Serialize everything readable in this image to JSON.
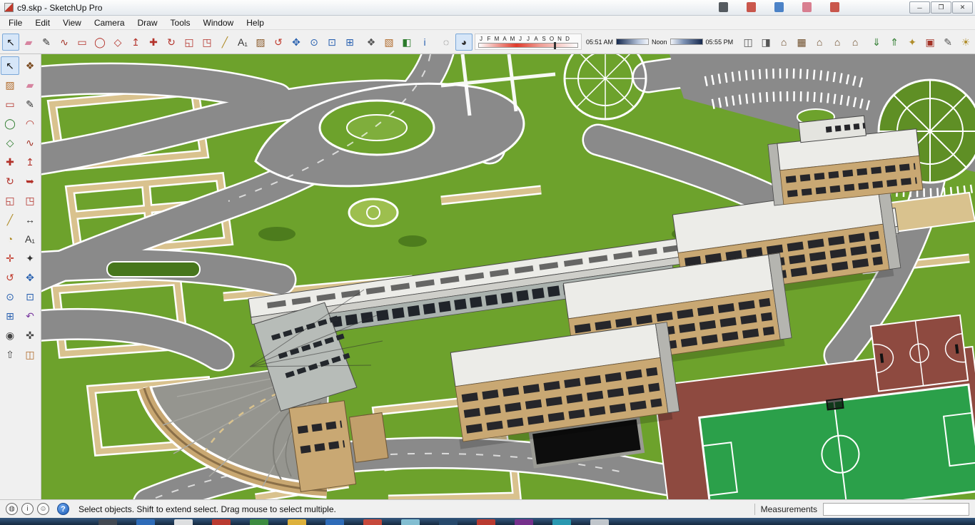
{
  "window": {
    "title": "c9.skp - SketchUp Pro",
    "controls": [
      {
        "name": "minimize-button",
        "glyph": "─"
      },
      {
        "name": "restore-button",
        "glyph": "❐"
      },
      {
        "name": "close-button",
        "glyph": "✕"
      }
    ]
  },
  "titlebar_artifacts": [
    "#3a3f45",
    "#c23b2e",
    "#2f6fbe",
    "#d46a7e",
    "#c23b2e"
  ],
  "menu": {
    "items": [
      {
        "name": "menu-file",
        "label": "File"
      },
      {
        "name": "menu-edit",
        "label": "Edit"
      },
      {
        "name": "menu-view",
        "label": "View"
      },
      {
        "name": "menu-camera",
        "label": "Camera"
      },
      {
        "name": "menu-draw",
        "label": "Draw"
      },
      {
        "name": "menu-tools",
        "label": "Tools"
      },
      {
        "name": "menu-window",
        "label": "Window"
      },
      {
        "name": "menu-help",
        "label": "Help"
      }
    ]
  },
  "toolbar": {
    "main_icons": [
      {
        "name": "select-icon",
        "glyph": "↖",
        "color": "#111111",
        "active": true
      },
      {
        "name": "eraser-icon",
        "glyph": "▰",
        "color": "#d784a0"
      },
      {
        "name": "line-icon",
        "glyph": "✎",
        "color": "#333333"
      },
      {
        "name": "freehand-icon",
        "glyph": "∿",
        "color": "#a33327"
      },
      {
        "name": "rectangle-icon",
        "glyph": "▭",
        "color": "#b3322a"
      },
      {
        "name": "circle-icon",
        "glyph": "◯",
        "color": "#b3322a"
      },
      {
        "name": "polygon-icon",
        "glyph": "◇",
        "color": "#b3322a"
      },
      {
        "name": "push-pull-icon",
        "glyph": "↥",
        "color": "#b3322a"
      },
      {
        "name": "move-icon",
        "glyph": "✚",
        "color": "#b3322a"
      },
      {
        "name": "rotate-icon",
        "glyph": "↻",
        "color": "#b3322a"
      },
      {
        "name": "scale-icon",
        "glyph": "◱",
        "color": "#b3322a"
      },
      {
        "name": "offset-icon",
        "glyph": "◳",
        "color": "#b3322a"
      },
      {
        "name": "tape-measure-icon",
        "glyph": "╱",
        "color": "#b08d2a"
      },
      {
        "name": "text-icon",
        "glyph": "A₁",
        "color": "#333333"
      },
      {
        "name": "paint-bucket-icon",
        "glyph": "▨",
        "color": "#8a5a2a"
      },
      {
        "name": "orbit-icon",
        "glyph": "↺",
        "color": "#c0392b"
      },
      {
        "name": "pan-icon",
        "glyph": "✥",
        "color": "#2a62b0"
      },
      {
        "name": "zoom-icon",
        "glyph": "⊙",
        "color": "#2a62b0"
      },
      {
        "name": "zoom-window-icon",
        "glyph": "⊡",
        "color": "#2a62b0"
      },
      {
        "name": "zoom-extents-icon",
        "glyph": "⊞",
        "color": "#2a62b0"
      }
    ],
    "mid_icons": [
      {
        "name": "make-component-icon",
        "glyph": "❖",
        "color": "#555555"
      },
      {
        "name": "materials-icon",
        "glyph": "▧",
        "color": "#b06a2a"
      },
      {
        "name": "styles-icon",
        "glyph": "◧",
        "color": "#2a7a2a"
      },
      {
        "name": "model-info-icon",
        "glyph": "i",
        "color": "#2a62b0"
      }
    ],
    "style_icons": [
      {
        "name": "x-ray-icon",
        "glyph": "◌",
        "color": "#555555"
      },
      {
        "name": "shaded-textures-icon",
        "glyph": "◕",
        "color": "#333333",
        "active": true
      }
    ],
    "shadow": {
      "months": [
        "J",
        "F",
        "M",
        "A",
        "M",
        "J",
        "J",
        "A",
        "S",
        "O",
        "N",
        "D"
      ],
      "time_start": "05:51 AM",
      "time_noon": "Noon",
      "time_end": "05:55 PM"
    },
    "right_icons": [
      {
        "name": "section-plane-icon",
        "glyph": "◫",
        "color": "#555555"
      },
      {
        "name": "section-cuts-icon",
        "glyph": "◨",
        "color": "#555555"
      },
      {
        "name": "iso-view-icon",
        "glyph": "⌂",
        "color": "#6b4a26"
      },
      {
        "name": "top-view-icon",
        "glyph": "▦",
        "color": "#6b4a26"
      },
      {
        "name": "front-view-icon",
        "glyph": "⌂",
        "color": "#6b4a26"
      },
      {
        "name": "right-view-icon",
        "glyph": "⌂",
        "color": "#6b4a26"
      },
      {
        "name": "back-view-icon",
        "glyph": "⌂",
        "color": "#6b4a26"
      }
    ],
    "far_right_icons": [
      {
        "name": "get-models-icon",
        "glyph": "⇓",
        "color": "#2a7a2a"
      },
      {
        "name": "share-model-icon",
        "glyph": "⇑",
        "color": "#2a7a2a"
      },
      {
        "name": "extension-warehouse-icon",
        "glyph": "✦",
        "color": "#b08d2a"
      },
      {
        "name": "layout-icon",
        "glyph": "▣",
        "color": "#a33327"
      },
      {
        "name": "style-builder-icon",
        "glyph": "✎",
        "color": "#555555"
      },
      {
        "name": "shadows-toggle-icon",
        "glyph": "☀",
        "color": "#b08d2a"
      },
      {
        "name": "preferences-icon",
        "glyph": "✔",
        "color": "#2a62b0"
      }
    ]
  },
  "palette": {
    "icons": [
      {
        "name": "lts-select-icon",
        "glyph": "↖",
        "color": "#111111",
        "active": true
      },
      {
        "name": "lts-make-component-icon",
        "glyph": "❖",
        "color": "#7a4a1e"
      },
      {
        "name": "lts-paint-bucket-icon",
        "glyph": "▨",
        "color": "#b06a2a"
      },
      {
        "name": "lts-eraser-icon",
        "glyph": "▰",
        "color": "#d784a0"
      },
      {
        "name": "lts-rectangle-icon",
        "glyph": "▭",
        "color": "#b3322a"
      },
      {
        "name": "lts-line-icon",
        "glyph": "✎",
        "color": "#333333"
      },
      {
        "name": "lts-circle-icon",
        "glyph": "◯",
        "color": "#2a7a2a"
      },
      {
        "name": "lts-arc-icon",
        "glyph": "◠",
        "color": "#b3322a"
      },
      {
        "name": "lts-polygon-icon",
        "glyph": "◇",
        "color": "#2a7a2a"
      },
      {
        "name": "lts-freehand-icon",
        "glyph": "∿",
        "color": "#a33327"
      },
      {
        "name": "lts-move-icon",
        "glyph": "✚",
        "color": "#b3322a"
      },
      {
        "name": "lts-push-pull-icon",
        "glyph": "↥",
        "color": "#b3322a"
      },
      {
        "name": "lts-rotate-icon",
        "glyph": "↻",
        "color": "#b3322a"
      },
      {
        "name": "lts-follow-me-icon",
        "glyph": "➥",
        "color": "#b3322a"
      },
      {
        "name": "lts-scale-icon",
        "glyph": "◱",
        "color": "#b3322a"
      },
      {
        "name": "lts-offset-icon",
        "glyph": "◳",
        "color": "#b3322a"
      },
      {
        "name": "lts-tape-measure-icon",
        "glyph": "╱",
        "color": "#b08d2a"
      },
      {
        "name": "lts-dimension-icon",
        "glyph": "↔",
        "color": "#333333"
      },
      {
        "name": "lts-protractor-icon",
        "glyph": "◔",
        "color": "#b08d2a"
      },
      {
        "name": "lts-text-icon",
        "glyph": "A₁",
        "color": "#333333"
      },
      {
        "name": "lts-axes-icon",
        "glyph": "✛",
        "color": "#c0392b"
      },
      {
        "name": "lts-3d-text-icon",
        "glyph": "✦",
        "color": "#333333"
      },
      {
        "name": "lts-orbit-icon",
        "glyph": "↺",
        "color": "#c0392b"
      },
      {
        "name": "lts-pan-icon",
        "glyph": "✥",
        "color": "#2a62b0"
      },
      {
        "name": "lts-zoom-icon",
        "glyph": "⊙",
        "color": "#2a62b0"
      },
      {
        "name": "lts-zoom-window-icon",
        "glyph": "⊡",
        "color": "#2a62b0"
      },
      {
        "name": "lts-zoom-extents-icon",
        "glyph": "⊞",
        "color": "#2a62b0"
      },
      {
        "name": "lts-previous-view-icon",
        "glyph": "↶",
        "color": "#7a3aa0"
      },
      {
        "name": "lts-position-camera-icon",
        "glyph": "◉",
        "color": "#444444"
      },
      {
        "name": "lts-look-around-icon",
        "glyph": "✜",
        "color": "#444444"
      },
      {
        "name": "lts-walk-icon",
        "glyph": "⇧",
        "color": "#444444"
      },
      {
        "name": "lts-section-plane-icon",
        "glyph": "◫",
        "color": "#b06a2a"
      }
    ]
  },
  "status": {
    "icons": [
      {
        "name": "geolocation-icon",
        "glyph": "◍",
        "color": "#444444"
      },
      {
        "name": "credits-icon",
        "glyph": "i",
        "color": "#444444"
      },
      {
        "name": "signin-icon",
        "glyph": "☺",
        "color": "#444444"
      }
    ],
    "help_glyph": "?",
    "message": "Select objects. Shift to extend select. Drag mouse to select multiple.",
    "measurements_label": "Measurements",
    "measurements_value": ""
  },
  "taskbar": {
    "colors": [
      "#444a52",
      "#2f6fbe",
      "#e8e8e8",
      "#c23b2e",
      "#3e8f3e",
      "#e8b73a",
      "#2f6fbe",
      "#d04a3a",
      "#88c5d8",
      "#274a6d",
      "#c23b2e",
      "#7a2f8e",
      "#2a9db5",
      "#c9cdd2"
    ]
  },
  "scene": {
    "grass_color": "#6da22c",
    "road_color": "#8a8a8a",
    "walkway_color": "#d9c28e",
    "building_wall_color": "#c9a873",
    "roof_color": "#ecece8",
    "window_color": "#26262a",
    "field_green": "#2ba04a",
    "track_maroon": "#8e4a40",
    "pond_color": "#0d0d0d"
  }
}
